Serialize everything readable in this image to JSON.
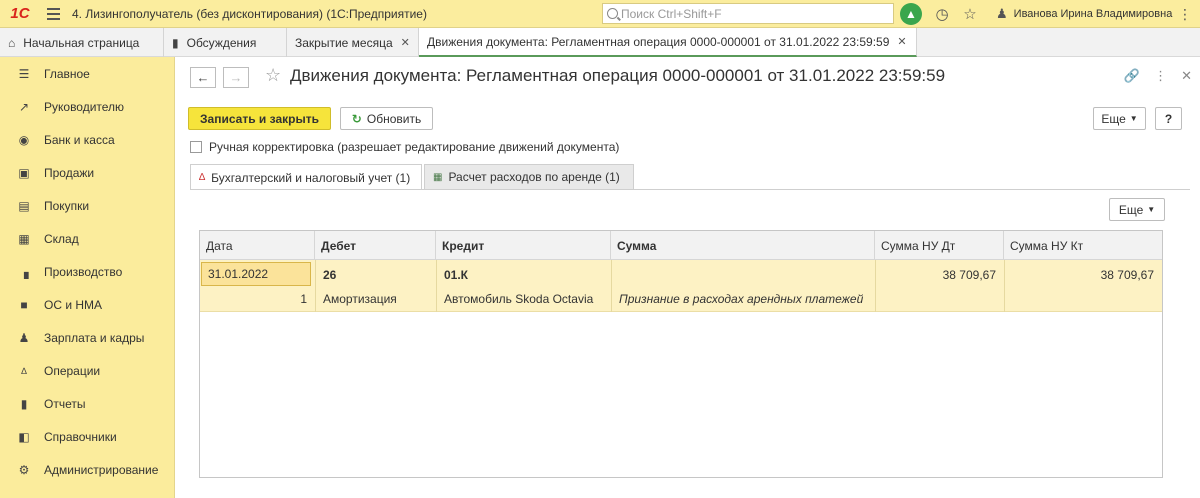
{
  "topbar": {
    "logo": "1С",
    "title": "4. Лизингополучатель (без дисконтирования)  (1С:Предприятие)",
    "search_placeholder": "Поиск Ctrl+Shift+F",
    "user": "Иванова Ирина Владимировна",
    "icons": [
      "bell-icon",
      "history-icon",
      "star-icon",
      "user-icon",
      "menu-icon"
    ]
  },
  "tabs": [
    {
      "label": "Начальная страница",
      "icon": "home-icon"
    },
    {
      "label": "Обсуждения",
      "icon": "chat-icon"
    },
    {
      "label": "Закрытие месяца",
      "closable": true
    },
    {
      "label": "Движения документа: Регламентная операция 0000-000001 от 31.01.2022 23:59:59",
      "closable": true,
      "active": true
    }
  ],
  "sidebar": {
    "items": [
      {
        "label": "Главное",
        "icon": "menu-lines-icon"
      },
      {
        "label": "Руководителю",
        "icon": "trend-icon"
      },
      {
        "label": "Банк и касса",
        "icon": "coin-icon"
      },
      {
        "label": "Продажи",
        "icon": "bag-icon"
      },
      {
        "label": "Покупки",
        "icon": "cart-icon"
      },
      {
        "label": "Склад",
        "icon": "warehouse-icon"
      },
      {
        "label": "Производство",
        "icon": "factory-icon"
      },
      {
        "label": "ОС и НМА",
        "icon": "truck-icon"
      },
      {
        "label": "Зарплата и кадры",
        "icon": "person-icon"
      },
      {
        "label": "Операции",
        "icon": "dt-kt-icon"
      },
      {
        "label": "Отчеты",
        "icon": "bar-chart-icon"
      },
      {
        "label": "Справочники",
        "icon": "books-icon"
      },
      {
        "label": "Администрирование",
        "icon": "gear-icon"
      }
    ]
  },
  "form": {
    "title": "Движения документа: Регламентная операция 0000-000001 от 31.01.2022 23:59:59",
    "save_close": "Записать и закрыть",
    "refresh": "Обновить",
    "more": "Еще",
    "help": "?",
    "manual_label": "Ручная корректировка (разрешает редактирование движений документа)",
    "manual_checked": false,
    "tabs": [
      {
        "label": "Бухгалтерский и налоговый учет (1)",
        "icon": "dt-kt-icon",
        "active": true
      },
      {
        "label": "Расчет расходов по аренде (1)",
        "icon": "table-icon",
        "active": false
      }
    ],
    "grid_more": "Еще"
  },
  "grid": {
    "headers": {
      "date": "Дата",
      "debit": "Дебет",
      "credit": "Кредит",
      "sum": "Сумма",
      "sum_nu_dt": "Сумма НУ Дт",
      "sum_nu_kt": "Сумма НУ Кт"
    },
    "rows": [
      {
        "date": "31.01.2022",
        "number": "1",
        "debit": "26",
        "debit_sub": "Амортизация",
        "credit": "01.К",
        "credit_sub": "Автомобиль Skoda Octavia",
        "sum": "",
        "content": "Признание в расходах арендных платежей",
        "sum_nu_dt": "38 709,67",
        "sum_nu_kt": "38 709,67"
      }
    ]
  }
}
